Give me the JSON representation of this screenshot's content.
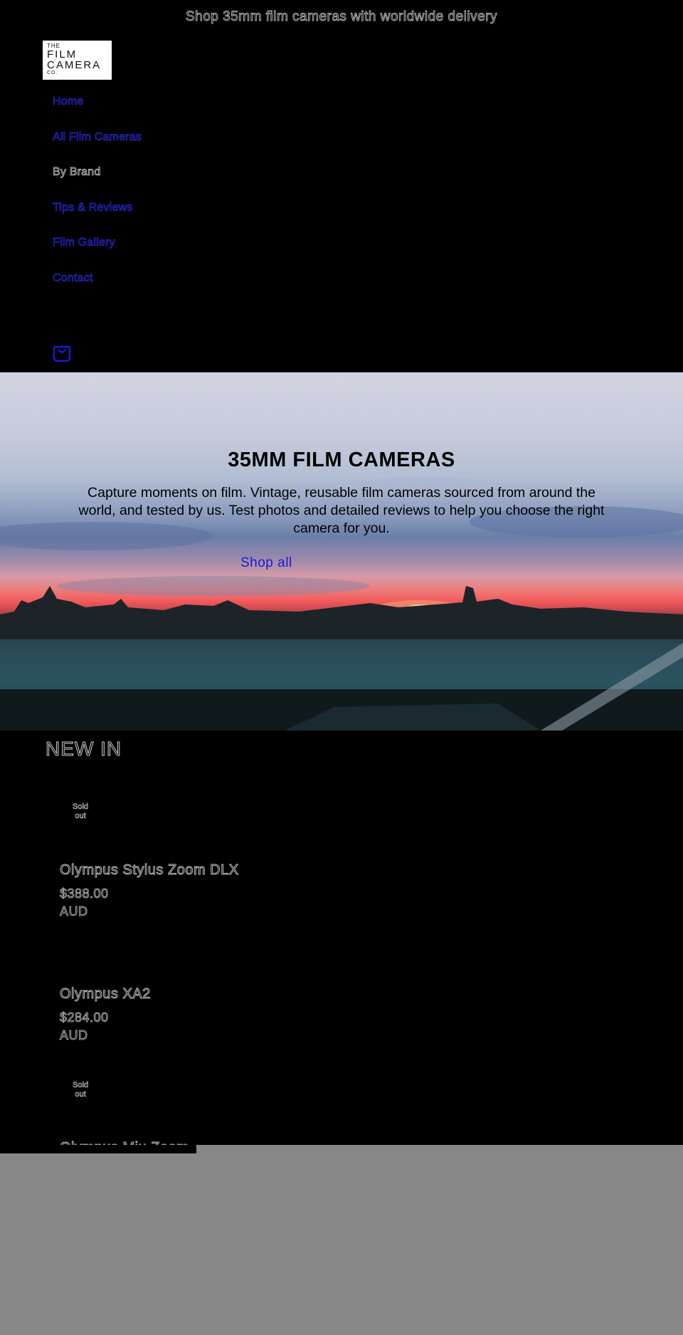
{
  "announcement": "Shop 35mm film cameras with worldwide delivery",
  "logo": {
    "line1": "THE",
    "line2": "FILM",
    "line3": "CAMERA",
    "line4": "CO."
  },
  "nav": [
    {
      "label": "Home"
    },
    {
      "label": "All Film Cameras"
    },
    {
      "label": "By Brand"
    },
    {
      "label": "Tips & Reviews"
    },
    {
      "label": "Film Gallery"
    },
    {
      "label": "Contact"
    }
  ],
  "cart": {
    "icon": "cart-icon"
  },
  "hero": {
    "title": "35MM FILM CAMERAS",
    "description": "Capture moments on film. Vintage, reusable film cameras sourced from around the world, and tested by us. Test photos and detailed reviews to help you choose the right camera for you.",
    "button": "Shop all"
  },
  "section": {
    "title": "NEW IN"
  },
  "products": [
    {
      "badge": "Sold out",
      "title": "Olympus Stylus Zoom DLX",
      "price": "$388.00",
      "currency": "AUD"
    },
    {
      "badge": "",
      "title": "Olympus XA2",
      "price": "$284.00",
      "currency": "AUD"
    },
    {
      "badge": "Sold out",
      "title": "Olympus Mju Zoom",
      "price": "",
      "currency": ""
    }
  ],
  "colors": {
    "accent": "#1a1ad8",
    "overlay": "#878787",
    "background": "#000000"
  }
}
